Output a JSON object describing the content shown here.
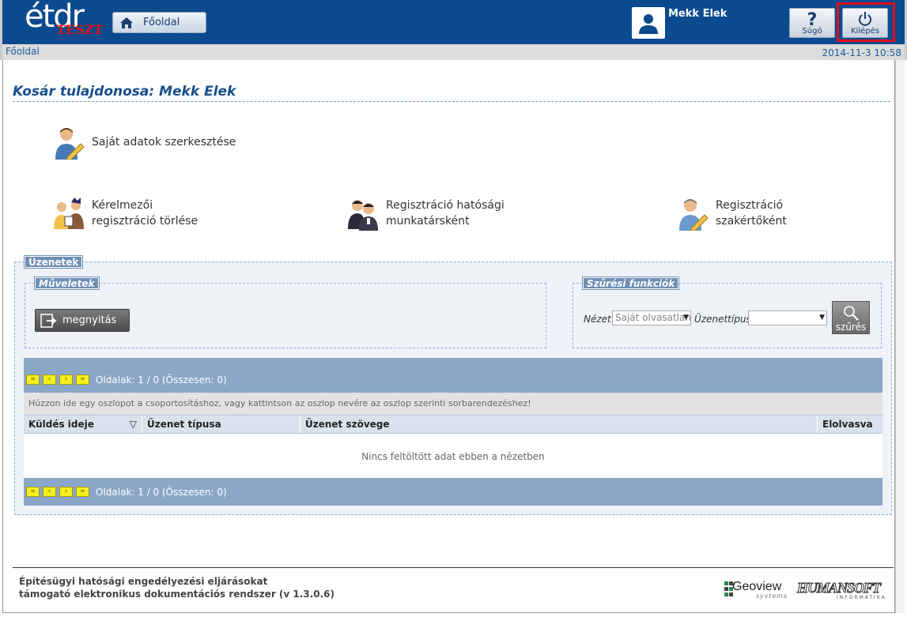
{
  "header": {
    "logo_text": "étdr",
    "logo_badge": "TESZT",
    "home_label": "Főoldal",
    "user_name": "Mekk Elek",
    "help_label": "Súgó",
    "exit_label": "Kilépés"
  },
  "breadcrumb": {
    "current": "Főoldal",
    "datetime": "2014-11-3 10:58"
  },
  "page": {
    "title": "Kosár tulajdonosa: Mekk Elek",
    "actions": {
      "edit_own": "Saját adatok szerkesztése",
      "delete_reg_line1": "Kérelmezői",
      "delete_reg_line2": "regisztráció törlése",
      "reg_authority_line1": "Regisztráció hatósági",
      "reg_authority_line2": "munkatársként",
      "reg_expert_line1": "Regisztráció",
      "reg_expert_line2": "szakértőként"
    }
  },
  "messages": {
    "legend": "Üzenetek",
    "operations_legend": "Műveletek",
    "open_button": "megnyitás",
    "filter_legend": "Szűrési funkciók",
    "view_label": "Nézet",
    "view_value": "Saját olvasatlan",
    "type_label": "Üzenettípus",
    "type_value": "",
    "filter_button": "szűrés",
    "pager_text": "Oldalak: 1 / 0 (Összesen: 0)",
    "group_hint": "Húzzon ide egy oszlopot a csoportosításhoz, vagy kattintson az oszlop nevére az oszlop szerinti sorbarendezéshez!",
    "columns": [
      "Küldés ideje",
      "Üzenet típusa",
      "Üzenet szövege",
      "Elolvasva"
    ],
    "sort_indicator": "▽",
    "empty_text": "Nincs feltöltött adat ebben a nézetben"
  },
  "footer": {
    "line1": "Építésügyi hatósági engedélyezési eljárásokat",
    "line2": "támogató elektronikus dokumentációs rendszer (v 1.3.0.6)",
    "logo1": "Geoview",
    "logo1_sub": "systems",
    "logo2": "HUMANSOFT",
    "logo2_sub": "INFORMATIKA"
  }
}
